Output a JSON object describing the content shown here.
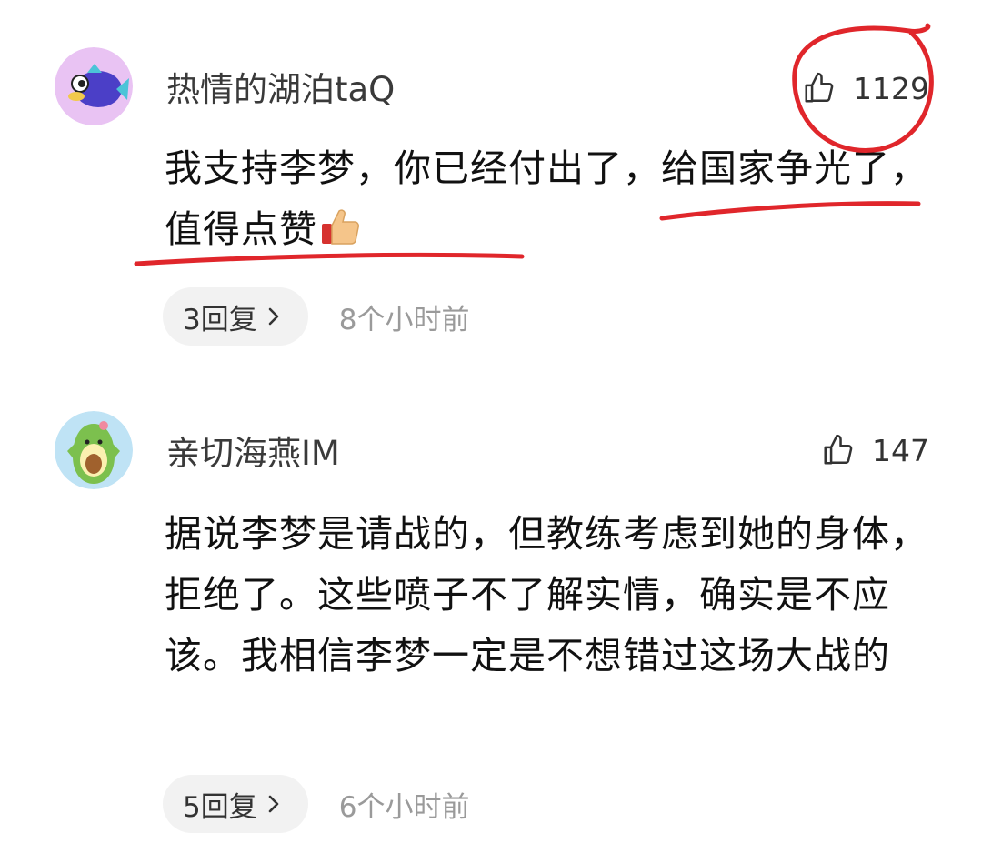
{
  "comments": [
    {
      "username": "热情的湖泊taQ",
      "likes": "1129",
      "text": "我支持李梦，你已经付出了，给国家争光了，值得点赞",
      "replies": "3回复",
      "time": "8个小时前",
      "avatar_icon": "fish-avatar-icon"
    },
    {
      "username": "亲切海燕IM",
      "likes": "147",
      "text": "据说李梦是请战的，但教练考虑到她的身体，拒绝了。这些喷子不了解实情，确实是不应该。我相信李梦一定是不想错过这场大战的",
      "replies": "5回复",
      "time": "6个小时前",
      "avatar_icon": "avocado-avatar-icon"
    }
  ],
  "colors": {
    "annotation_red": "#e0262b",
    "pill_bg": "#f2f2f2",
    "time_gray": "#9a9a9a"
  }
}
